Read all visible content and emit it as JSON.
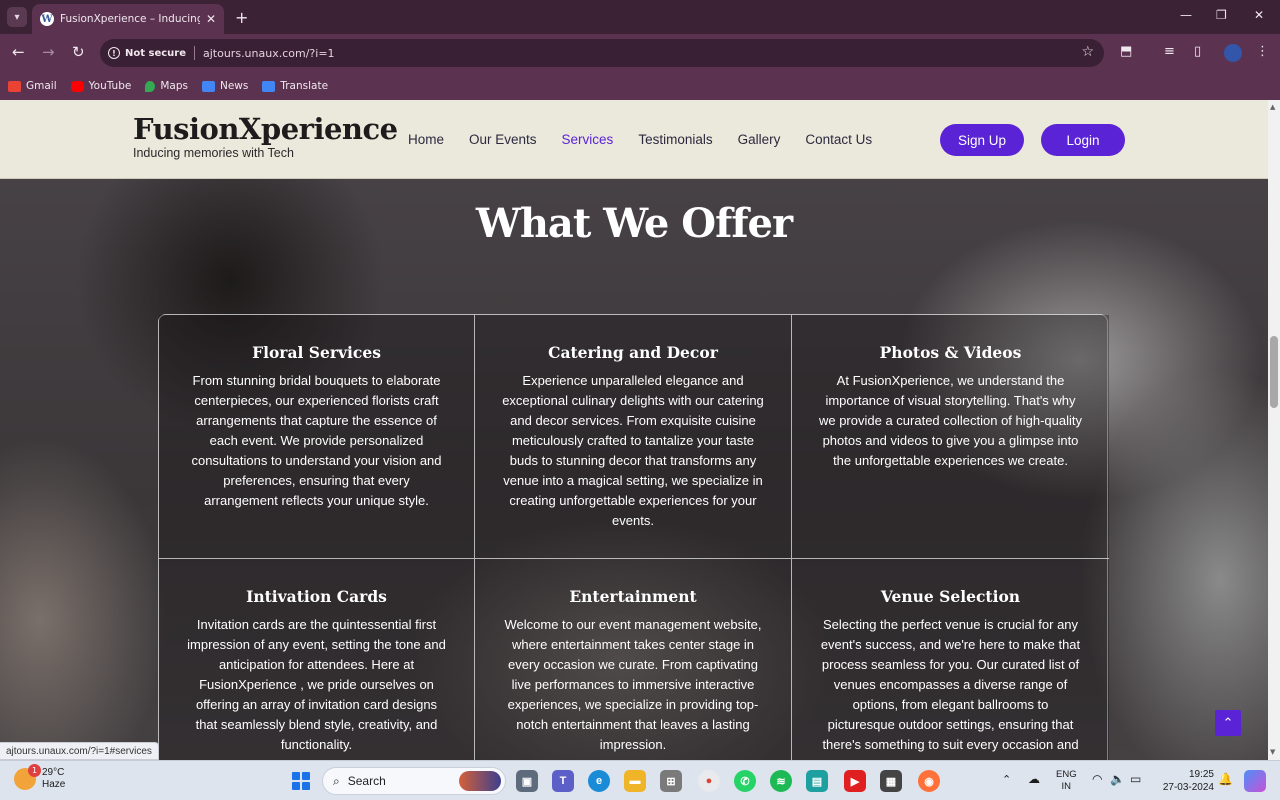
{
  "browser": {
    "tab_title": "FusionXperience – Inducing me",
    "security_label": "Not secure",
    "url": "ajtours.unaux.com/?i=1",
    "bookmarks": [
      {
        "label": "Gmail",
        "icon": "gmail-icon",
        "color": "#ea4335"
      },
      {
        "label": "YouTube",
        "icon": "youtube-icon",
        "color": "#ff0000"
      },
      {
        "label": "Maps",
        "icon": "maps-icon",
        "color": "#34a853"
      },
      {
        "label": "News",
        "icon": "news-icon",
        "color": "#4285f4"
      },
      {
        "label": "Translate",
        "icon": "translate-icon",
        "color": "#4285f4"
      }
    ]
  },
  "site": {
    "brand": "FusionXperience",
    "tagline": "Inducing memories with Tech",
    "nav": [
      "Home",
      "Our Events",
      "Services",
      "Testimonials",
      "Gallery",
      "Contact Us"
    ],
    "active_nav": "Services",
    "signup_label": "Sign Up",
    "login_label": "Login",
    "accent_color": "#5b23d6",
    "section_title": "What We Offer",
    "services": [
      {
        "title": "Floral Services",
        "text": "From stunning bridal bouquets to elaborate centerpieces, our experienced florists craft arrangements that capture the essence of each event. We provide personalized consultations to understand your vision and preferences, ensuring that every arrangement reflects your unique style."
      },
      {
        "title": "Catering and Decor",
        "text": "Experience unparalleled elegance and exceptional culinary delights with our catering and decor services. From exquisite cuisine meticulously crafted to tantalize your taste buds to stunning decor that transforms any venue into a magical setting, we specialize in creating unforgettable experiences for your events."
      },
      {
        "title": "Photos & Videos",
        "text": "At FusionXperience, we understand the importance of visual storytelling. That's why we provide a curated collection of high-quality photos and videos to give you a glimpse into the unforgettable experiences we create."
      },
      {
        "title": "Intivation Cards",
        "text": "Invitation cards are the quintessential first impression of any event, setting the tone and anticipation for attendees. Here at FusionXperience , we pride ourselves on offering an array of invitation card designs that seamlessly blend style, creativity, and functionality."
      },
      {
        "title": "Entertainment",
        "text": "Welcome to our event management website, where entertainment takes center stage in every occasion we curate. From captivating live performances to immersive interactive experiences, we specialize in providing top-notch entertainment that leaves a lasting impression."
      },
      {
        "title": "Venue Selection",
        "text": "Selecting the perfect venue is crucial for any event's success, and we're here to make that process seamless for you. Our curated list of venues encompasses a diverse range of options, from elegant ballrooms to picturesque outdoor settings, ensuring that there's something to suit every occasion and"
      }
    ],
    "status_url": "ajtours.unaux.com/?i=1#services"
  },
  "taskbar": {
    "weather_temp": "29°C",
    "weather_desc": "Haze",
    "weather_badge": "1",
    "search_label": "Search",
    "lang_line1": "ENG",
    "lang_line2": "IN",
    "time": "19:25",
    "date": "27-03-2024"
  }
}
